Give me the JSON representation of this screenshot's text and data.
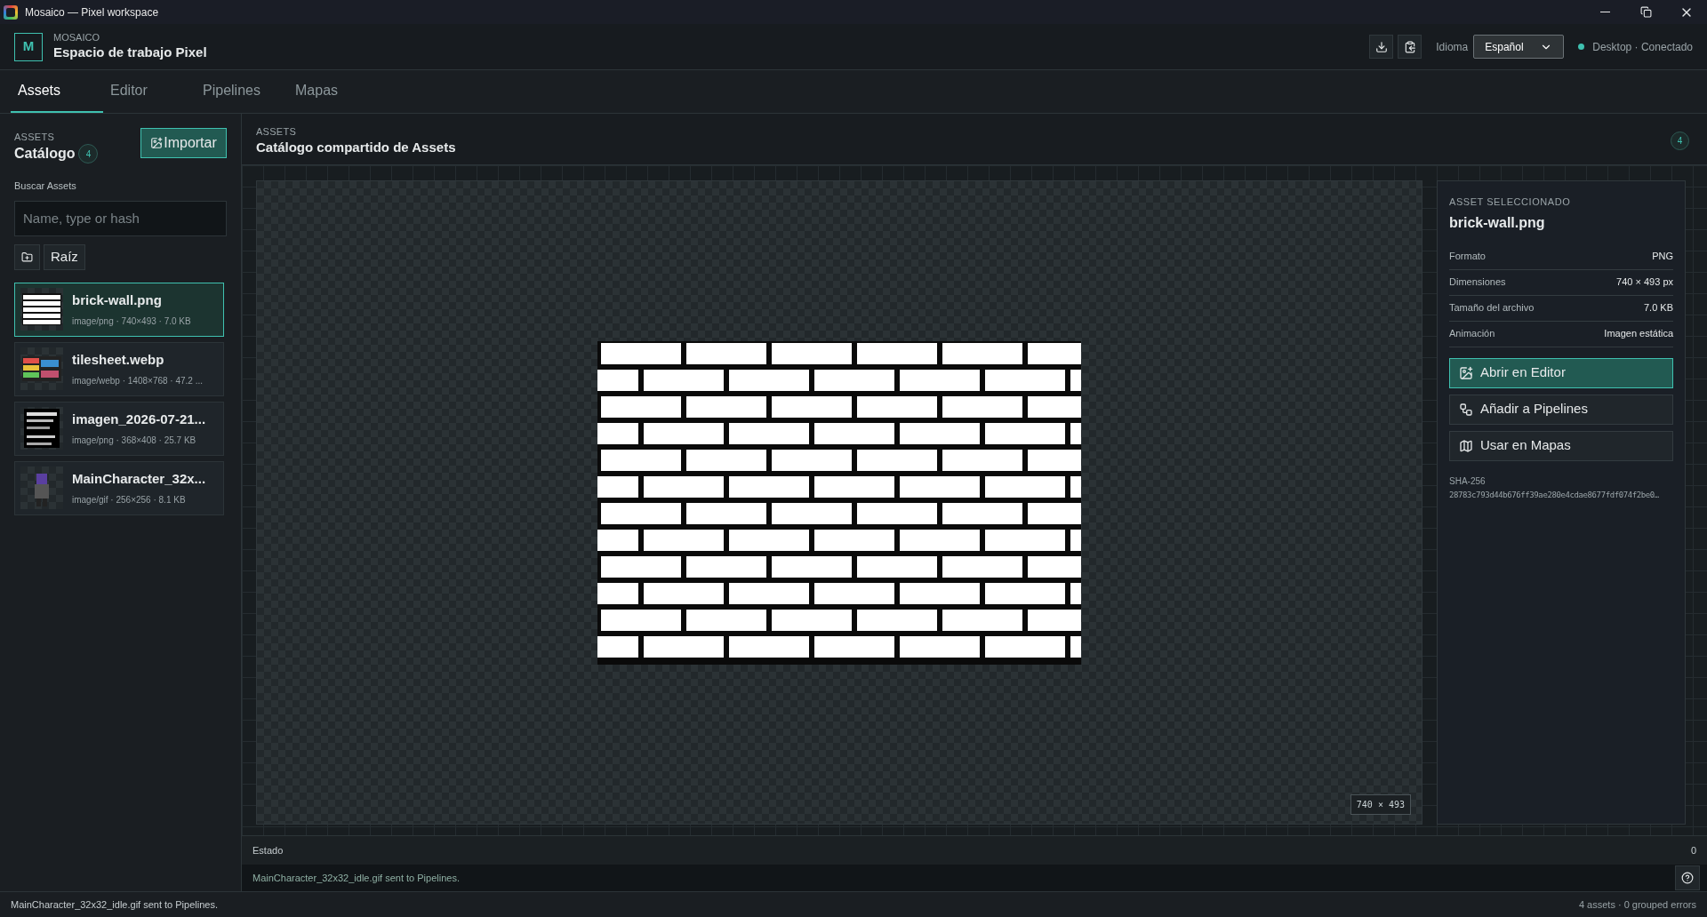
{
  "window": {
    "title": "Mosaico — Pixel workspace"
  },
  "header": {
    "logo_letter": "M",
    "brand": "MOSAICO",
    "title": "Espacio de trabajo Pixel",
    "language_label": "Idioma",
    "language": "Español",
    "connection": {
      "label": "Desktop · Conectado",
      "connected": true
    }
  },
  "tabs": [
    {
      "label": "Assets",
      "selected": true
    },
    {
      "label": "Editor",
      "selected": false
    },
    {
      "label": "Pipelines",
      "selected": false
    },
    {
      "label": "Mapas",
      "selected": false
    }
  ],
  "sidebar": {
    "section": "ASSETS",
    "title": "Catálogo",
    "count": "4",
    "import_button": "Importar",
    "search_label": "Buscar Assets",
    "search_placeholder": "Name, type or hash",
    "folder": "Raíz",
    "assets": [
      {
        "name": "brick-wall.png",
        "meta": "image/png · 740×493 · 7.0 KB",
        "selected": true
      },
      {
        "name": "tilesheet.webp",
        "meta": "image/webp · 1408×768 · 47.2 ...",
        "selected": false
      },
      {
        "name": "imagen_2026-07-21...",
        "meta": "image/png · 368×408 · 25.7 KB",
        "selected": false
      },
      {
        "name": "MainCharacter_32x...",
        "meta": "image/gif · 256×256 · 8.1 KB",
        "selected": false
      }
    ]
  },
  "main": {
    "section": "ASSETS",
    "title": "Catálogo compartido de Assets",
    "count": "4",
    "preview_size": "740 × 493"
  },
  "details": {
    "section": "ASSET SELECCIONADO",
    "name": "brick-wall.png",
    "rows": [
      {
        "label": "Formato",
        "value": "PNG"
      },
      {
        "label": "Dimensiones",
        "value": "740 × 493 px"
      },
      {
        "label": "Tamaño del archivo",
        "value": "7.0 KB"
      },
      {
        "label": "Animación",
        "value": "Imagen estática"
      }
    ],
    "actions": [
      {
        "label": "Abrir en Editor",
        "kind": "editor",
        "primary": true
      },
      {
        "label": "Añadir a Pipelines",
        "kind": "pipelines",
        "primary": false
      },
      {
        "label": "Usar en Mapas",
        "kind": "maps",
        "primary": false
      }
    ],
    "hash_label": "SHA-256",
    "hash": "28783c793d44b676ff39ae280e4cdae8677fdf074f2be0…"
  },
  "status_panel": {
    "title": "Estado",
    "count": "0",
    "message": "MainCharacter_32x32_idle.gif sent to Pipelines."
  },
  "status_bar": {
    "message": "MainCharacter_32x32_idle.gif sent to Pipelines.",
    "summary": "4 assets · 0 grouped errors"
  }
}
